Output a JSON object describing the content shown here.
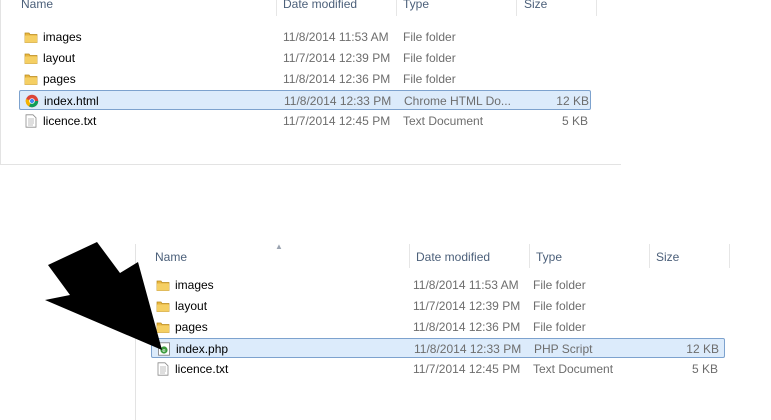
{
  "columns": {
    "name": "Name",
    "date": "Date modified",
    "type": "Type",
    "size": "Size"
  },
  "top_files": [
    {
      "name": "images",
      "date": "11/8/2014 11:53 AM",
      "type": "File folder",
      "size": "",
      "icon": "folder-icon"
    },
    {
      "name": "layout",
      "date": "11/7/2014 12:39 PM",
      "type": "File folder",
      "size": "",
      "icon": "folder-icon"
    },
    {
      "name": "pages",
      "date": "11/8/2014 12:36 PM",
      "type": "File folder",
      "size": "",
      "icon": "folder-icon"
    },
    {
      "name": "index.html",
      "date": "11/8/2014 12:33 PM",
      "type": "Chrome HTML Do...",
      "size": "12 KB",
      "icon": "chrome-html-icon",
      "selected": true
    },
    {
      "name": "licence.txt",
      "date": "11/7/2014 12:45 PM",
      "type": "Text Document",
      "size": "5 KB",
      "icon": "text-document-icon"
    }
  ],
  "bottom_files": [
    {
      "name": "images",
      "date": "11/8/2014 11:53 AM",
      "type": "File folder",
      "size": "",
      "icon": "folder-icon"
    },
    {
      "name": "layout",
      "date": "11/7/2014 12:39 PM",
      "type": "File folder",
      "size": "",
      "icon": "folder-icon"
    },
    {
      "name": "pages",
      "date": "11/8/2014 12:36 PM",
      "type": "File folder",
      "size": "",
      "icon": "folder-icon"
    },
    {
      "name": "index.php",
      "date": "11/8/2014 12:33 PM",
      "type": "PHP Script",
      "size": "12 KB",
      "icon": "php-script-icon",
      "selected": true
    },
    {
      "name": "licence.txt",
      "date": "11/7/2014 12:45 PM",
      "type": "Text Document",
      "size": "5 KB",
      "icon": "text-document-icon"
    }
  ],
  "colors": {
    "header_text": "#4c607a",
    "selection_fill": "#dcebfb",
    "selection_border": "#7da2ce",
    "folder": "#e8b640",
    "arrow": "#000000"
  }
}
